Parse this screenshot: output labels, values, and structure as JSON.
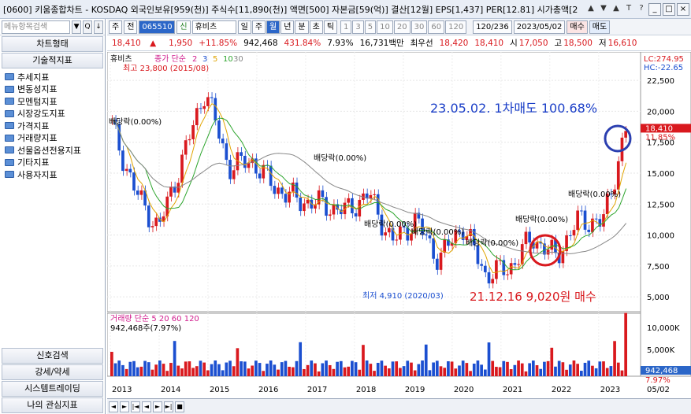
{
  "window": {
    "title": "[0600] 키움종합차트 - KOSDAQ 외국인보유[959(천)] 주식수[11,890(천)] 액면[500] 자본금[59(억)] 결산[12월] EPS[1,437] PER[12.81] 시가총액[2",
    "icons": [
      "▲",
      "▼",
      "▲",
      "T",
      "?"
    ],
    "buttons": [
      "_",
      "□",
      "×"
    ]
  },
  "sidebar": {
    "search_placeholder": "메뉴항목검색",
    "chart_type_label": "차트형태",
    "indicator_label": "기술적지표",
    "tree_items": [
      "추세지표",
      "변동성지표",
      "모멘텀지표",
      "시장강도지표",
      "가격지표",
      "거래량지표",
      "선물옵션전용지표",
      "기타지표",
      "사용자지표"
    ],
    "bottom_buttons": [
      "신호검색",
      "강세/약세",
      "시스템트레이딩",
      "나의 관심지표"
    ]
  },
  "toolbar": {
    "period_sel": "주",
    "prev_label": "전",
    "code": "065510",
    "name_tag": "신",
    "name": "휴비츠",
    "period_buttons": [
      "일",
      "주",
      "월",
      "년",
      "분",
      "초",
      "틱"
    ],
    "active_period": "월",
    "interval_buttons": [
      "1",
      "3",
      "5",
      "10",
      "20",
      "30",
      "60",
      "120"
    ],
    "range": "120/236",
    "date": "2023/05/02",
    "buy_label": "매수",
    "sell_label": "매도"
  },
  "quote": {
    "price": "18,410",
    "price_arrow": "▲",
    "change": "1,950",
    "change_pct": "+11.85%",
    "volume": "942,468",
    "vol_ratio": "431.84%",
    "turnover": "7.93%",
    "amount": "16,731백만",
    "best_ask_label": "최우선",
    "best_ask": "18,420",
    "best_bid": "18,410",
    "open_label": "시",
    "open": "17,050",
    "high_label": "고",
    "high": "18,500",
    "low_label": "저",
    "low": "16,610"
  },
  "chart": {
    "legend_name": "휴비츠",
    "legend_ma": "종가 단순",
    "ma_periods": [
      "2",
      "3",
      "5",
      "10",
      "30"
    ],
    "ma_colors": [
      "#d01b8c",
      "#1b4fd0",
      "#e0a400",
      "#2ea52e",
      "#888888"
    ],
    "high_label": "최고 23,800 (2015/08)",
    "low_label": "최저 4,910 (2020/03)",
    "lc": "LC:274.95",
    "hc": "HC:-22.65",
    "price_ticks": [
      "22,500",
      "20,000",
      "17,500",
      "15,000",
      "12,500",
      "10,000",
      "7,500",
      "5,000"
    ],
    "cur_price_tag": "18,410",
    "cur_pct_tag": "11.85%",
    "dividend_label": "배당락(0.00%)",
    "annotation_sell": "23.05.02. 1차매도 100.68%",
    "annotation_buy": "21.12.16  9,020원  매수",
    "volume_legend": "거래량  단순 5  20  60  120",
    "volume_ma_colors": [
      "#d01b8c",
      "#e0a400",
      "#2ea52e",
      "#888888"
    ],
    "volume_value": "942,468주(7.97%)",
    "vol_ticks": [
      "10,000K",
      "5,000K"
    ],
    "vol_tag": "942,468",
    "vol_pct_tag": "7.97%",
    "years": [
      "2013",
      "2014",
      "2015",
      "2016",
      "2017",
      "2018",
      "2019",
      "2020",
      "2021",
      "2022",
      "2023"
    ],
    "year_last": "05/02",
    "up_color": "#d9191e",
    "down_color": "#1b4fd0"
  },
  "chart_data": {
    "type": "candlestick",
    "title": "휴비츠",
    "xlabel": "",
    "ylabel": "",
    "ylim": [
      3800,
      24800
    ],
    "x": [
      "2013",
      "2014",
      "2015",
      "2016",
      "2017",
      "2018",
      "2019",
      "2020",
      "2021",
      "2022",
      "2023"
    ],
    "series": [
      {
        "name": "휴비츠",
        "values": [
          18800,
          13500,
          10500,
          16000,
          21800,
          15500,
          16000,
          13800,
          12800,
          12500,
          11900,
          13300,
          9400,
          11200,
          8000,
          10800,
          6800,
          7300,
          9800,
          8200,
          11300,
          10900,
          18410
        ]
      }
    ],
    "points": [
      {
        "label": "최고",
        "value": 23800,
        "date": "2015/08"
      },
      {
        "label": "최저",
        "value": 4910,
        "date": "2020/03"
      },
      {
        "label": "매수",
        "value": 9020,
        "date": "21.12.16"
      },
      {
        "label": "1차매도",
        "value": 18410,
        "date": "23.05.02",
        "return_pct": 100.68
      }
    ]
  }
}
